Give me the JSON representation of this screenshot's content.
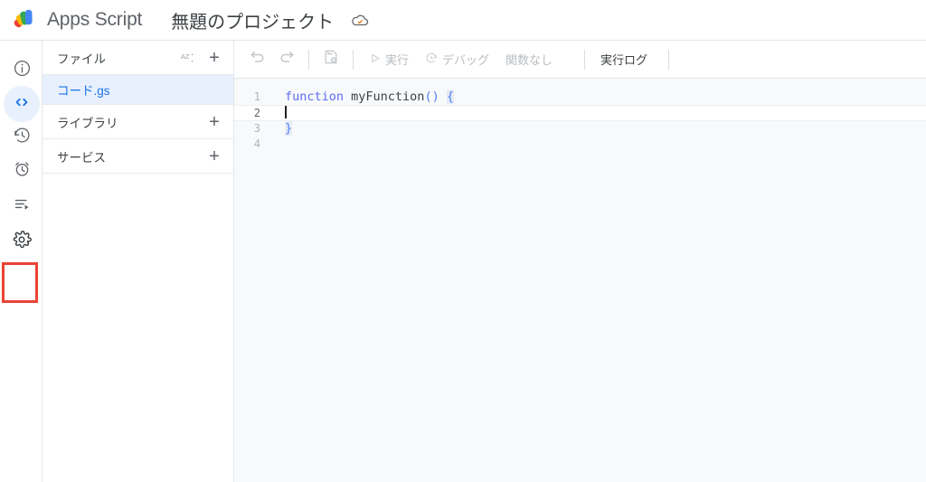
{
  "topbar": {
    "logo_icon": "apps-script-logo",
    "brand": "Apps Script",
    "project_title": "無題のプロジェクト",
    "cloud_icon": "cloud-saved-icon"
  },
  "rail": {
    "items": [
      {
        "icon": "info-icon",
        "name": "overview",
        "active": false
      },
      {
        "icon": "code-icon",
        "name": "editor",
        "active": true
      },
      {
        "icon": "history-icon",
        "name": "versions",
        "active": false
      },
      {
        "icon": "alarm-clock-icon",
        "name": "triggers",
        "active": false
      },
      {
        "icon": "executions-icon",
        "name": "executions",
        "active": false
      },
      {
        "icon": "gear-icon",
        "name": "settings",
        "active": false
      }
    ],
    "highlight_color": "#ea4335",
    "active_bg": "#e8f0fe"
  },
  "file_panel": {
    "files_header": "ファイル",
    "sort_icon": "sort-az-icon",
    "add_file_icon": "plus-icon",
    "selected_file": "コード.gs",
    "libraries_header": "ライブラリ",
    "services_header": "サービス",
    "selected_bg": "#e8f0fe",
    "selected_fg": "#1a73e8"
  },
  "toolbar": {
    "undo_icon": "undo-icon",
    "redo_icon": "redo-icon",
    "save_icon": "save-to-drive-icon",
    "run_icon": "play-icon",
    "run_label": "実行",
    "debug_icon": "debug-icon",
    "debug_label": "デバッグ",
    "function_select": "関数なし",
    "exec_log_label": "実行ログ"
  },
  "code": {
    "lines": [
      {
        "num": "1",
        "active": false,
        "tokens": [
          {
            "t": "function ",
            "c": "kw"
          },
          {
            "t": "myFunction",
            "c": "fn"
          },
          {
            "t": "()",
            "c": "pn"
          },
          {
            "t": " ",
            "c": "fn"
          },
          {
            "t": "{",
            "c": "br"
          }
        ]
      },
      {
        "num": "2",
        "active": true,
        "tokens": []
      },
      {
        "num": "3",
        "active": false,
        "tokens": [
          {
            "t": "}",
            "c": "br"
          }
        ]
      },
      {
        "num": "4",
        "active": false,
        "tokens": []
      }
    ],
    "cursor_line": 2,
    "background": "#f8f9fa"
  }
}
